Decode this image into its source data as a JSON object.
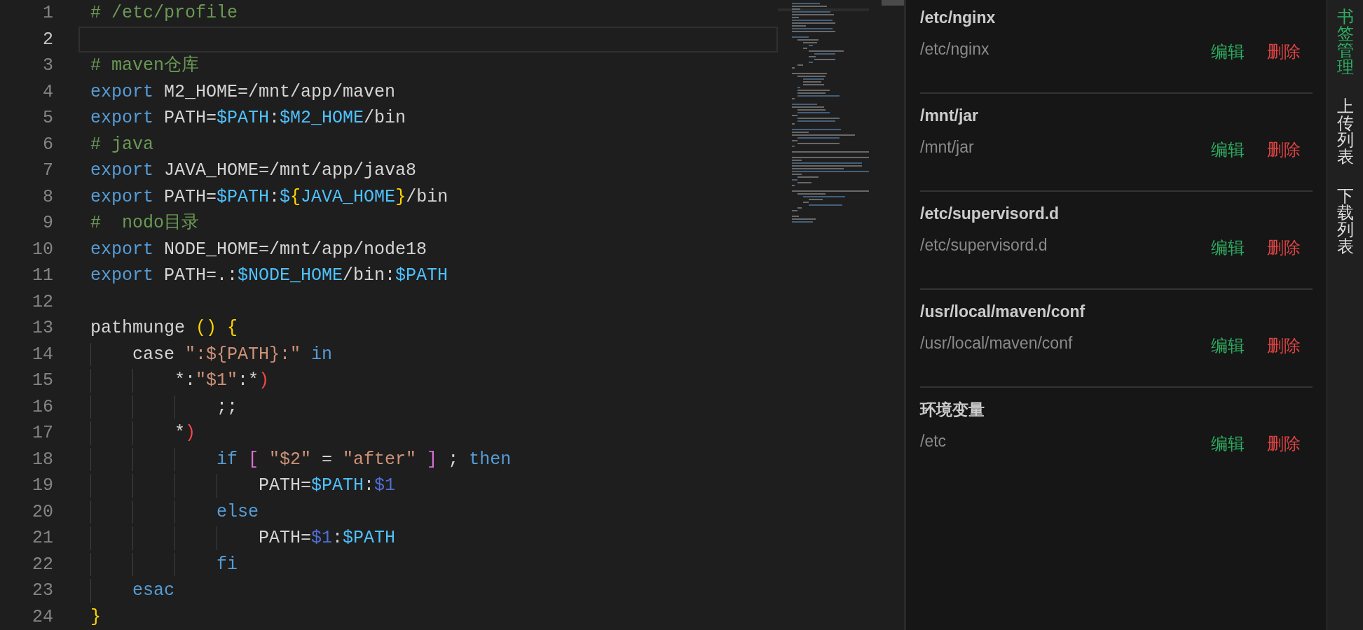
{
  "editor": {
    "lines": [
      {
        "number": "1",
        "current": false,
        "tokens": [
          {
            "kind": "comment",
            "text": "# /etc/profile"
          }
        ]
      },
      {
        "number": "2",
        "current": true
      },
      {
        "number": "3",
        "current": false,
        "tokens": [
          {
            "kind": "comment",
            "text": "# maven仓库"
          }
        ]
      },
      {
        "number": "4",
        "current": false,
        "tokens": [
          {
            "kind": "keyword",
            "text": "export"
          },
          {
            "kind": "plain",
            "text": " M2_HOME=/mnt/app/maven"
          }
        ]
      },
      {
        "number": "5",
        "current": false,
        "tokens": [
          {
            "kind": "keyword",
            "text": "export"
          },
          {
            "kind": "plain",
            "text": " PATH="
          },
          {
            "kind": "variable",
            "text": "$PATH"
          },
          {
            "kind": "plain",
            "text": ":"
          },
          {
            "kind": "variable",
            "text": "$M2_HOME"
          },
          {
            "kind": "plain",
            "text": "/bin"
          }
        ]
      },
      {
        "number": "6",
        "current": false,
        "tokens": [
          {
            "kind": "comment",
            "text": "# java"
          }
        ]
      },
      {
        "number": "7",
        "current": false,
        "tokens": [
          {
            "kind": "keyword",
            "text": "export"
          },
          {
            "kind": "plain",
            "text": " JAVA_HOME=/mnt/app/java8"
          }
        ]
      },
      {
        "number": "8",
        "current": false,
        "tokens": [
          {
            "kind": "keyword",
            "text": "export"
          },
          {
            "kind": "plain",
            "text": " PATH="
          },
          {
            "kind": "variable",
            "text": "$PATH"
          },
          {
            "kind": "plain",
            "text": ":"
          },
          {
            "kind": "variable",
            "text": "$"
          },
          {
            "kind": "brace",
            "text": "{"
          },
          {
            "kind": "variable",
            "text": "JAVA_HOME"
          },
          {
            "kind": "brace",
            "text": "}"
          },
          {
            "kind": "plain",
            "text": "/bin"
          }
        ]
      },
      {
        "number": "9",
        "current": false,
        "tokens": [
          {
            "kind": "comment",
            "text": "#  nodo目录"
          }
        ]
      },
      {
        "number": "10",
        "current": false,
        "tokens": [
          {
            "kind": "keyword",
            "text": "export"
          },
          {
            "kind": "plain",
            "text": " NODE_HOME=/mnt/app/node18"
          }
        ]
      },
      {
        "number": "11",
        "current": false,
        "tokens": [
          {
            "kind": "keyword",
            "text": "export"
          },
          {
            "kind": "plain",
            "text": " PATH=.:"
          },
          {
            "kind": "variable",
            "text": "$NODE_HOME"
          },
          {
            "kind": "plain",
            "text": "/bin:"
          },
          {
            "kind": "variable",
            "text": "$PATH"
          }
        ]
      },
      {
        "number": "12",
        "current": false
      },
      {
        "number": "13",
        "current": false,
        "tokens": [
          {
            "kind": "plain",
            "text": "pathmunge "
          },
          {
            "kind": "brace",
            "text": "() {"
          }
        ],
        "children": [
          {
            "number": "14",
            "current": false,
            "tokens": [
              {
                "kind": "plain",
                "text": "case "
              },
              {
                "kind": "string",
                "text": "\":${PATH}:\""
              },
              {
                "kind": "keyword",
                "text": " in"
              }
            ],
            "children": [
              {
                "number": "15",
                "current": false,
                "tokens": [
                  {
                    "kind": "plain",
                    "text": "*:"
                  },
                  {
                    "kind": "string",
                    "text": "\"$1\""
                  },
                  {
                    "kind": "plain",
                    "text": ":*"
                  },
                  {
                    "kind": "error",
                    "text": ")"
                  }
                ],
                "children": [
                  {
                    "number": "16",
                    "current": false,
                    "tokens": [
                      {
                        "kind": "plain",
                        "text": ";;"
                      }
                    ]
                  }
                ]
              },
              {
                "number": "17",
                "current": false,
                "tokens": [
                  {
                    "kind": "plain",
                    "text": "*"
                  },
                  {
                    "kind": "error",
                    "text": ")"
                  }
                ],
                "children": [
                  {
                    "number": "18",
                    "current": false,
                    "tokens": [
                      {
                        "kind": "keyword",
                        "text": "if"
                      },
                      {
                        "kind": "bracket",
                        "text": " ["
                      },
                      {
                        "kind": "string",
                        "text": " \"$2\""
                      },
                      {
                        "kind": "plain",
                        "text": " = "
                      },
                      {
                        "kind": "string",
                        "text": "\"after\""
                      },
                      {
                        "kind": "bracket",
                        "text": " ]"
                      },
                      {
                        "kind": "plain",
                        "text": " ; "
                      },
                      {
                        "kind": "keyword",
                        "text": "then"
                      }
                    ],
                    "children": [
                      {
                        "number": "19",
                        "current": false,
                        "tokens": [
                          {
                            "kind": "plain",
                            "text": "PATH="
                          },
                          {
                            "kind": "variable",
                            "text": "$PATH"
                          },
                          {
                            "kind": "plain",
                            "text": ":"
                          },
                          {
                            "kind": "parameter",
                            "text": "$1"
                          }
                        ]
                      }
                    ]
                  },
                  {
                    "number": "20",
                    "current": false,
                    "tokens": [
                      {
                        "kind": "keyword",
                        "text": "else"
                      }
                    ],
                    "children": [
                      {
                        "number": "21",
                        "current": false,
                        "tokens": [
                          {
                            "kind": "plain",
                            "text": "PATH="
                          },
                          {
                            "kind": "parameter",
                            "text": "$1"
                          },
                          {
                            "kind": "plain",
                            "text": ":"
                          },
                          {
                            "kind": "variable",
                            "text": "$PATH"
                          }
                        ]
                      }
                    ]
                  },
                  {
                    "number": "22",
                    "current": false,
                    "tokens": [
                      {
                        "kind": "keyword",
                        "text": "fi"
                      }
                    ]
                  }
                ]
              }
            ]
          },
          {
            "number": "23",
            "current": false,
            "tokens": [
              {
                "kind": "keyword",
                "text": "esac"
              }
            ]
          }
        ]
      },
      {
        "number": "24",
        "current": false,
        "tokens": [
          {
            "kind": "brace",
            "text": "}"
          }
        ]
      }
    ]
  },
  "bookmarks": {
    "items": [
      {
        "title": "/etc/nginx",
        "path": "/etc/nginx",
        "edit": "编辑",
        "delete": "删除"
      },
      {
        "title": "/mnt/jar",
        "path": "/mnt/jar",
        "edit": "编辑",
        "delete": "删除"
      },
      {
        "title": "/etc/supervisord.d",
        "path": "/etc/supervisord.d",
        "edit": "编辑",
        "delete": "删除"
      },
      {
        "title": "/usr/local/maven/conf",
        "path": "/usr/local/maven/conf",
        "edit": "编辑",
        "delete": "删除"
      },
      {
        "title": "环境变量",
        "path": "/etc",
        "edit": "编辑",
        "delete": "删除"
      }
    ]
  },
  "side_tabs": [
    {
      "label": "书签管理",
      "selected": true
    },
    {
      "label": "上传列表",
      "selected": false
    },
    {
      "label": "下载列表",
      "selected": false
    }
  ]
}
